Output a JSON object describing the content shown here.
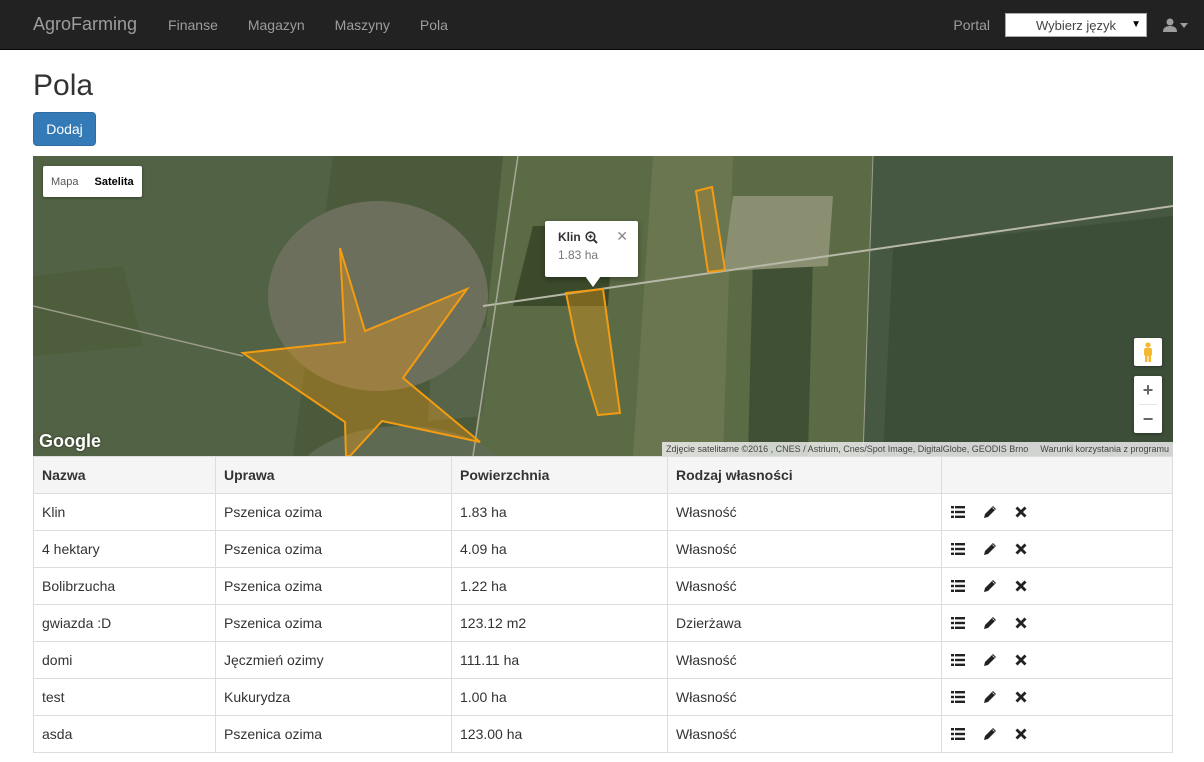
{
  "navbar": {
    "brand": "AgroFarming",
    "links": [
      "Finanse",
      "Magazyn",
      "Maszyny",
      "Pola"
    ],
    "portal": "Portal",
    "language_select": "Wybierz język"
  },
  "page": {
    "title": "Pola",
    "add_button": "Dodaj"
  },
  "map": {
    "type_buttons": [
      "Mapa",
      "Satelita"
    ],
    "active_type": "Satelita",
    "popup": {
      "title": "Klin",
      "area": "1.83 ha"
    },
    "logo": "Google",
    "attribution": "Zdjęcie satelitarne ©2016 , CNES / Astrium, Cnes/Spot Image, DigitalGlobe, GEODIS Brno",
    "terms": "Warunki korzystania z programu",
    "colors": {
      "field_stroke": "#f39c12",
      "field_fill": "#f39c12"
    }
  },
  "table": {
    "headers": [
      "Nazwa",
      "Uprawa",
      "Powierzchnia",
      "Rodzaj własności",
      ""
    ],
    "rows": [
      {
        "name": "Klin",
        "crop": "Pszenica ozima",
        "area": "1.83 ha",
        "ownership": "Własność"
      },
      {
        "name": "4 hektary",
        "crop": "Pszenica ozima",
        "area": "4.09 ha",
        "ownership": "Własność"
      },
      {
        "name": "Bolibrzucha",
        "crop": "Pszenica ozima",
        "area": "1.22 ha",
        "ownership": "Własność"
      },
      {
        "name": "gwiazda :D",
        "crop": "Pszenica ozima",
        "area": "123.12 m2",
        "ownership": "Dzierżawa"
      },
      {
        "name": "domi",
        "crop": "Jęczmień ozimy",
        "area": "111.11 ha",
        "ownership": "Własność"
      },
      {
        "name": "test",
        "crop": "Kukurydza",
        "area": "1.00 ha",
        "ownership": "Własność"
      },
      {
        "name": "asda",
        "crop": "Pszenica ozima",
        "area": "123.00 ha",
        "ownership": "Własność"
      }
    ],
    "row_icons": [
      "list-icon",
      "pencil-icon",
      "remove-icon"
    ]
  }
}
